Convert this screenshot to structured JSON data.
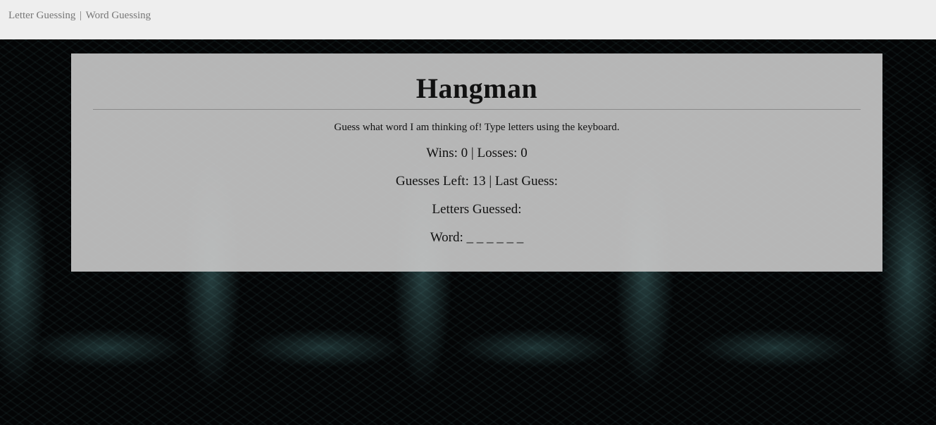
{
  "nav": {
    "letter_guessing": "Letter Guessing",
    "separator": "|",
    "word_guessing": "Word Guessing"
  },
  "game": {
    "title": "Hangman",
    "instructions": "Guess what word I am thinking of! Type letters using the keyboard.",
    "wins_line": "Wins: 0 | Losses: 0",
    "guesses_line": "Guesses Left: 13 | Last Guess:",
    "letters_line": "Letters Guessed:",
    "word_line": "Word: _ _ _ _ _ _"
  },
  "colors": {
    "topbar_bg": "#eeeeee",
    "nav_text": "#777777",
    "panel_bg": "#c6c6c6",
    "page_bg": "#050607"
  }
}
